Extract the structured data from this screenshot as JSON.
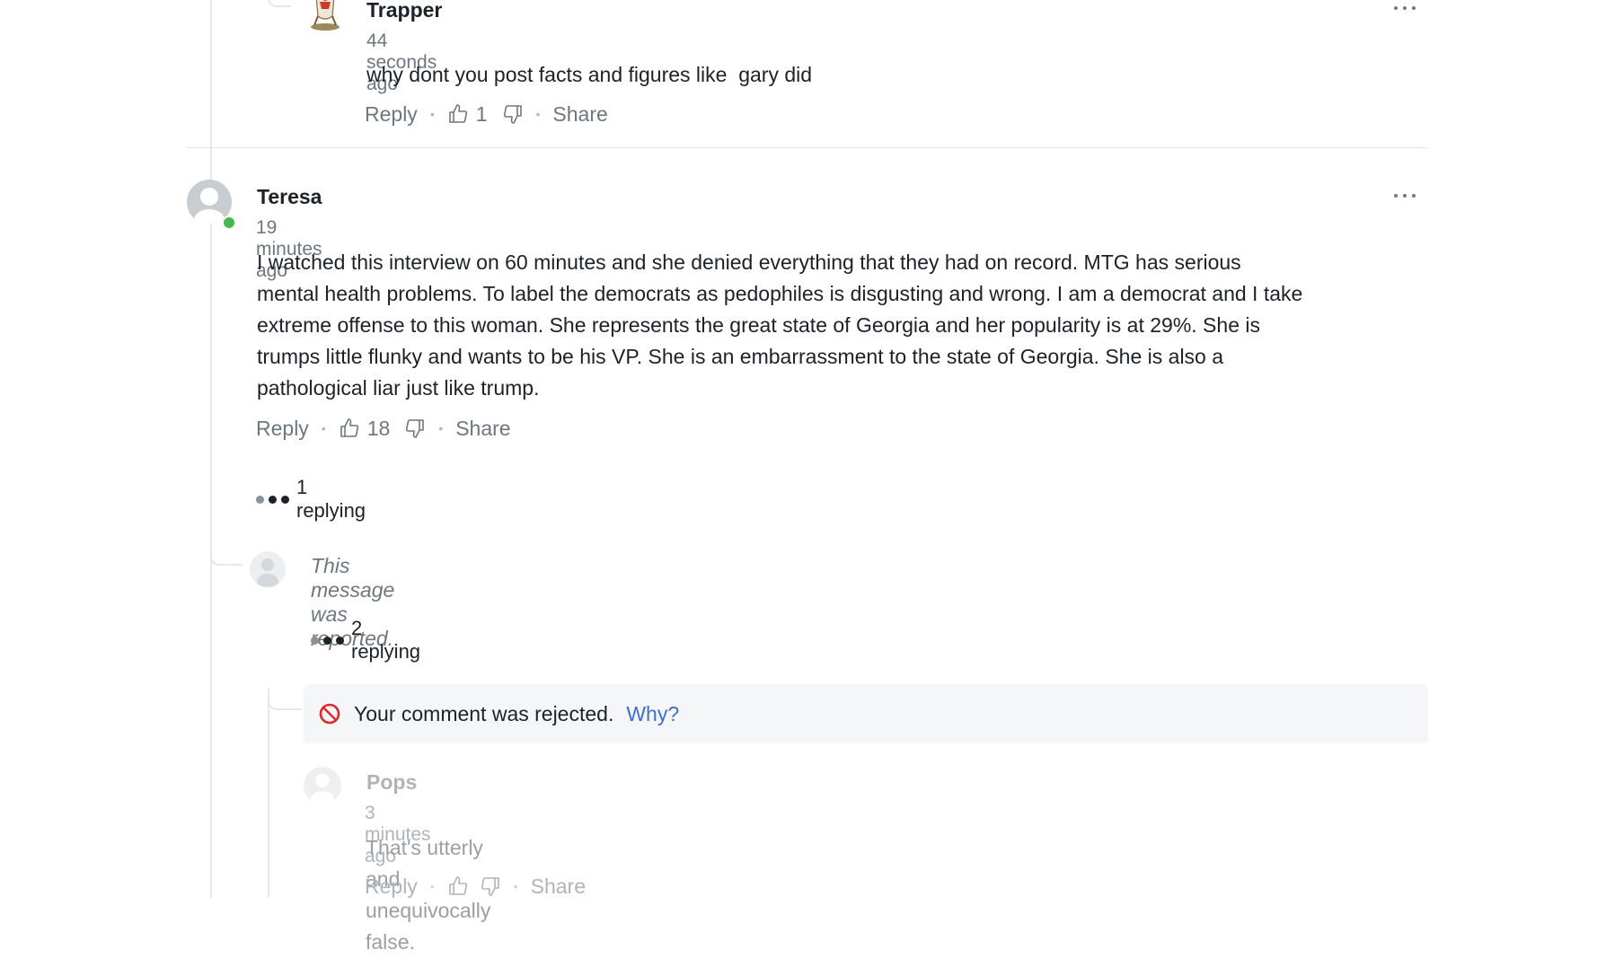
{
  "comments": {
    "trapper": {
      "name": "Trapper",
      "time": "44 seconds ago",
      "text": "why dont you post facts and figures like  gary did",
      "reply_label": "Reply",
      "likes": "1",
      "share_label": "Share"
    },
    "teresa": {
      "name": "Teresa",
      "time": "19 minutes ago",
      "text": "I watched this interview on 60 minutes and she denied everything that they had on record. MTG has serious mental health problems. To label the democrats as pedophiles is disgusting and wrong. I am a democrat and I take extreme offense to this woman. She represents the great state of Georgia and her popularity is at 29%. She is trumps little flunky and wants to be his VP. She is an embarrassment to the state of Georgia. She is also a pathological liar just like trump.",
      "reply_label": "Reply",
      "likes": "18",
      "share_label": "Share",
      "replying": "1 replying",
      "online_color": "#3fb950"
    },
    "reported": {
      "text": "This message was reported.",
      "replying": "2 replying"
    },
    "rejected": {
      "text": "Your comment was rejected.",
      "why_label": "Why?",
      "icon_color": "#e0292b",
      "link_color": "#3d6fd1"
    },
    "pops": {
      "name": "Pops",
      "time": "3 minutes ago",
      "text": "That's utterly and unequivocally false.",
      "reply_label": "Reply",
      "share_label": "Share"
    }
  }
}
